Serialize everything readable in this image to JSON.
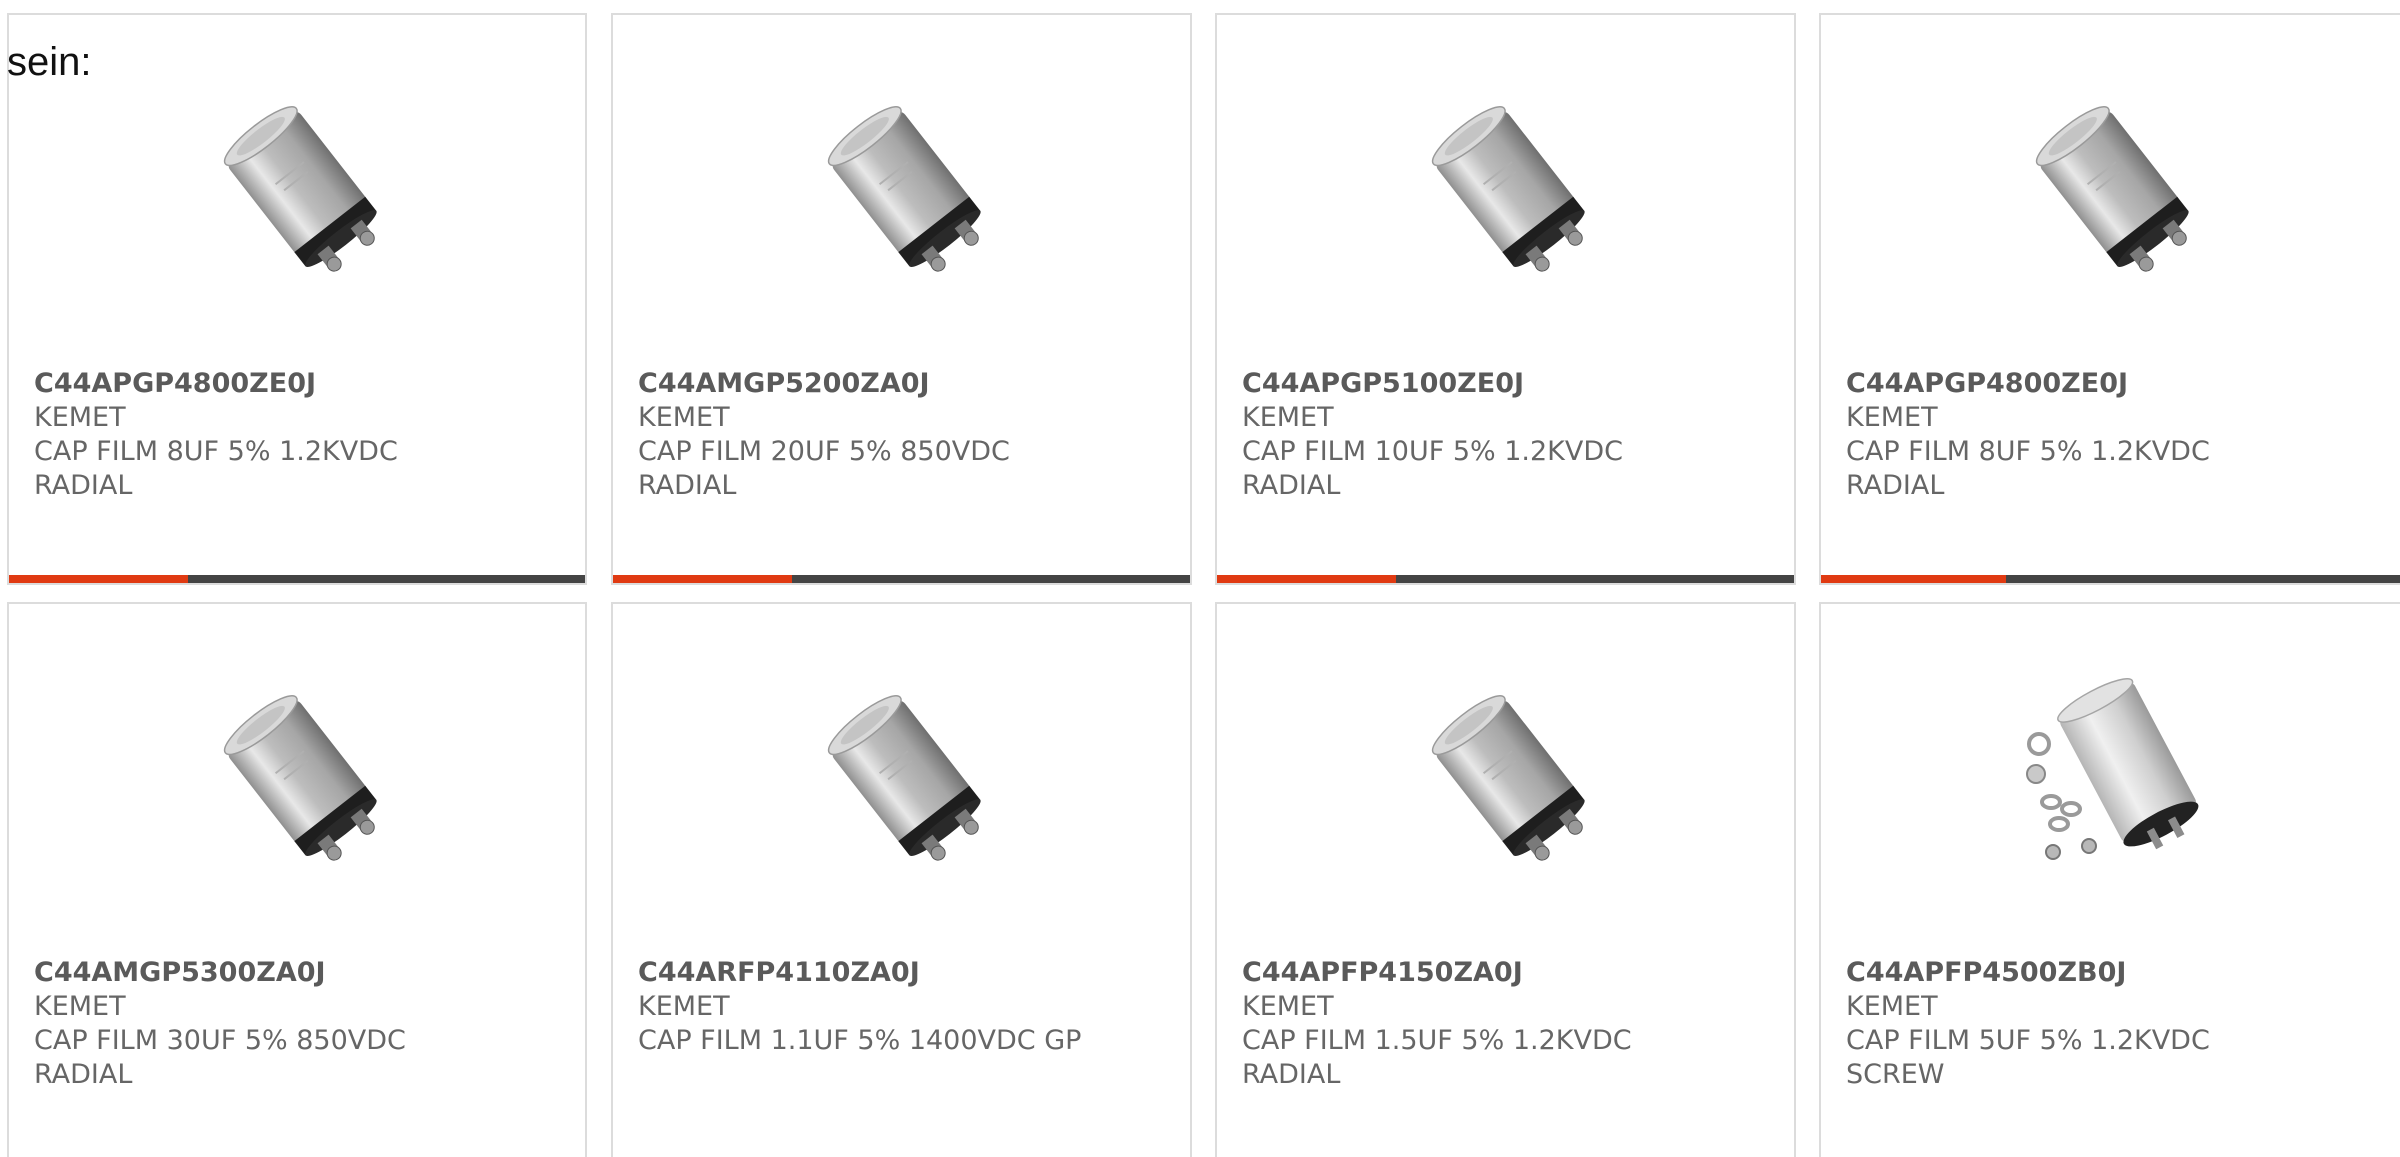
{
  "intro_text": "sein:",
  "colors": {
    "accent": "#e03a12",
    "bar_track": "#444444",
    "card_border": "#dcdcdc",
    "text": "#666666"
  },
  "products": [
    {
      "part": "C44APGP4800ZE0J",
      "maker": "KEMET",
      "desc": "CAP FILM 8UF 5% 1.2KVDC",
      "package": "RADIAL",
      "image": "capacitor-image",
      "progress": 0.31
    },
    {
      "part": "C44AMGP5200ZA0J",
      "maker": "KEMET",
      "desc": "CAP FILM 20UF 5% 850VDC",
      "package": "RADIAL",
      "image": "capacitor-image",
      "progress": 0.31
    },
    {
      "part": "C44APGP5100ZE0J",
      "maker": "KEMET",
      "desc": "CAP FILM 10UF 5% 1.2KVDC",
      "package": "RADIAL",
      "image": "capacitor-image",
      "progress": 0.31
    },
    {
      "part": "C44APGP4800ZE0J",
      "maker": "KEMET",
      "desc": "CAP FILM 8UF 5% 1.2KVDC",
      "package": "RADIAL",
      "image": "capacitor-image",
      "progress": 0.31
    },
    {
      "part": "C44AMGP5300ZA0J",
      "maker": "KEMET",
      "desc": "CAP FILM 30UF 5% 850VDC",
      "package": "RADIAL",
      "image": "capacitor-image"
    },
    {
      "part": "C44ARFP4110ZA0J",
      "maker": "KEMET",
      "desc": "CAP FILM 1.1UF 5% 1400VDC GP",
      "package": "",
      "image": "capacitor-image"
    },
    {
      "part": "C44APFP4150ZA0J",
      "maker": "KEMET",
      "desc": "CAP FILM 1.5UF 5% 1.2KVDC",
      "package": "RADIAL",
      "image": "capacitor-image"
    },
    {
      "part": "C44APFP4500ZB0J",
      "maker": "KEMET",
      "desc": "CAP FILM 5UF 5% 1.2KVDC",
      "package": "SCREW",
      "image": "screw-capacitor-image"
    }
  ]
}
